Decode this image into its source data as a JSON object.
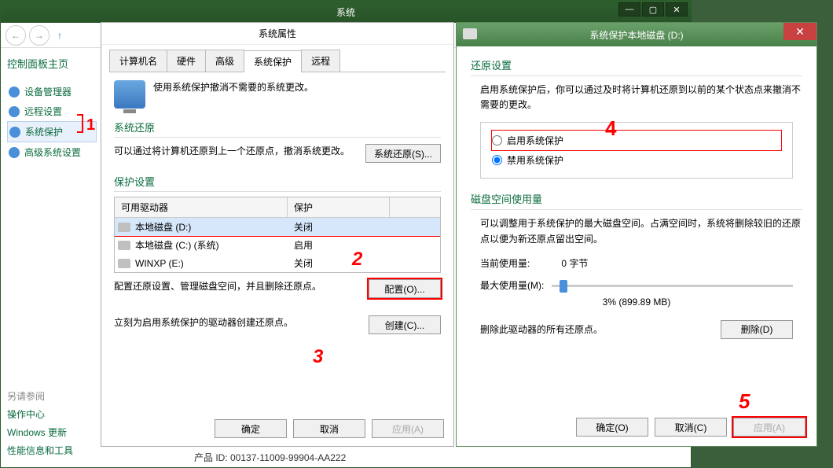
{
  "system_window": {
    "title": "系统",
    "sidebar_heading": "控制面板主页",
    "links": [
      {
        "label": "设备管理器",
        "icon": "#4a90d9"
      },
      {
        "label": "远程设置",
        "icon": "#4a90d9"
      },
      {
        "label": "系统保护",
        "icon": "#4a90d9"
      },
      {
        "label": "高级系统设置",
        "icon": "#4a90d9"
      }
    ],
    "see_also_heading": "另请参阅",
    "see_also": [
      "操作中心",
      "Windows 更新",
      "性能信息和工具"
    ],
    "product_id": "产品 ID: 00137-11009-99904-AA222"
  },
  "props_dialog": {
    "title": "系统属性",
    "tabs": [
      "计算机名",
      "硬件",
      "高级",
      "系统保护",
      "远程"
    ],
    "active_tab": 3,
    "intro": "使用系统保护撤消不需要的系统更改。",
    "restore_section": "系统还原",
    "restore_text": "可以通过将计算机还原到上一个还原点，撤消系统更改。",
    "restore_btn": "系统还原(S)...",
    "settings_section": "保护设置",
    "col_drive": "可用驱动器",
    "col_prot": "保护",
    "drives": [
      {
        "name": "本地磁盘 (D:)",
        "prot": "关闭",
        "selected": true
      },
      {
        "name": "本地磁盘 (C:) (系统)",
        "prot": "启用"
      },
      {
        "name": "WINXP (E:)",
        "prot": "关闭"
      }
    ],
    "config_text": "配置还原设置、管理磁盘空间，并且删除还原点。",
    "config_btn": "配置(O)...",
    "create_text": "立刻为启用系统保护的驱动器创建还原点。",
    "create_btn": "创建(C)...",
    "ok": "确定",
    "cancel": "取消",
    "apply": "应用(A)"
  },
  "prot_dialog": {
    "title": "系统保护本地磁盘 (D:)",
    "restore_section": "还原设置",
    "restore_text": "启用系统保护后，你可以通过及时将计算机还原到以前的某个状态点来撤消不需要的更改。",
    "radio_enable": "启用系统保护",
    "radio_disable": "禁用系统保护",
    "disk_section": "磁盘空间使用量",
    "disk_text": "可以调整用于系统保护的最大磁盘空间。占满空间时，系统将删除较旧的还原点以便为新还原点留出空间。",
    "current_label": "当前使用量:",
    "current_value": "0 字节",
    "max_label": "最大使用量(M):",
    "slider_value": "3% (899.89 MB)",
    "delete_text": "删除此驱动器的所有还原点。",
    "delete_btn": "删除(D)",
    "ok": "确定(O)",
    "cancel": "取消(C)",
    "apply": "应用(A)"
  },
  "annotations": {
    "a1": "1",
    "a2": "2",
    "a3": "3",
    "a4": "4",
    "a5": "5"
  }
}
